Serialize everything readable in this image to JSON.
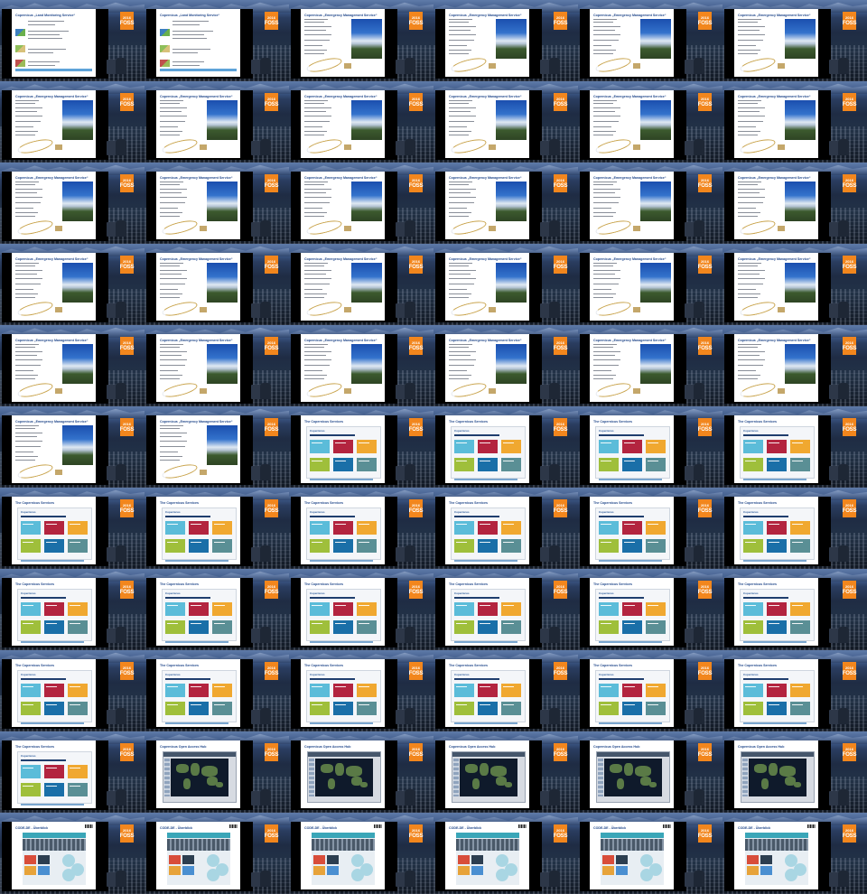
{
  "event": {
    "logo_year": "2016",
    "logo_name": "FOSS"
  },
  "slide_types": {
    "landmon": {
      "title": "Copernicus „Land Monitoring Service“",
      "kind": "landmon"
    },
    "emergency": {
      "title": "Copernicus „Emergency Management Service“",
      "kind": "emergency"
    },
    "services": {
      "title": "The Copernicus Services",
      "kind": "services",
      "panel_heading": "Copernicus"
    },
    "hub": {
      "title": "Copernicus Open Access Hub",
      "kind": "hub"
    },
    "codede": {
      "title": "CODE-DE - Überblick",
      "kind": "codede"
    }
  },
  "frames": [
    "landmon",
    "landmon",
    "emergency",
    "emergency",
    "emergency",
    "emergency",
    "emergency",
    "emergency",
    "emergency",
    "emergency",
    "emergency",
    "emergency",
    "emergency",
    "emergency",
    "emergency",
    "emergency",
    "emergency",
    "emergency",
    "emergency",
    "emergency",
    "emergency",
    "emergency",
    "emergency",
    "emergency",
    "emergency",
    "emergency",
    "emergency",
    "emergency",
    "emergency",
    "emergency",
    "emergency",
    "emergency",
    "services",
    "services",
    "services",
    "services",
    "services",
    "services",
    "services",
    "services",
    "services",
    "services",
    "services",
    "services",
    "services",
    "services",
    "services",
    "services",
    "services",
    "services",
    "services",
    "services",
    "services",
    "services",
    "services",
    "hub",
    "hub",
    "hub",
    "hub",
    "hub",
    "codede",
    "codede",
    "codede",
    "codede",
    "codede",
    "codede"
  ],
  "colors": {
    "services_boxes": [
      "#5bbcd9",
      "#b3243f",
      "#f0a830",
      "#9fbf3b",
      "#1a6fa8",
      "#5a8f95"
    ],
    "logo": "#f2861d",
    "title": "#244a8c"
  }
}
